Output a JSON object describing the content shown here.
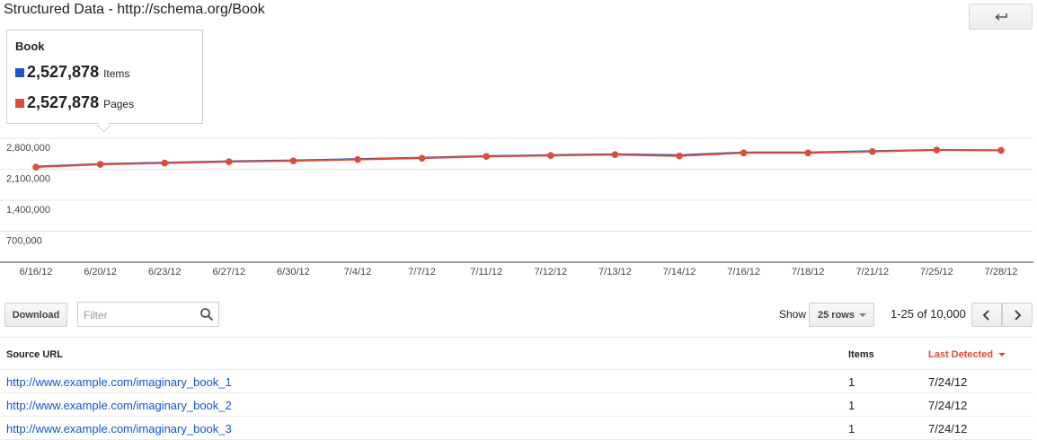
{
  "header": {
    "title": "Structured Data - http://schema.org/Book",
    "back_icon": "back-arrow-icon"
  },
  "tooltip": {
    "title": "Book",
    "metrics": [
      {
        "value": "2,527,878",
        "label": "Items",
        "color": "#1a56c9"
      },
      {
        "value": "2,527,878",
        "label": "Pages",
        "color": "#dd4b39"
      }
    ]
  },
  "chart_data": {
    "type": "line",
    "x": [
      "6/16/12",
      "6/20/12",
      "6/23/12",
      "6/27/12",
      "6/30/12",
      "7/4/12",
      "7/7/12",
      "7/11/12",
      "7/12/12",
      "7/13/12",
      "7/14/12",
      "7/16/12",
      "7/18/12",
      "7/21/12",
      "7/25/12",
      "7/28/12"
    ],
    "yticks": [
      "2,800,000",
      "2,100,000",
      "1,400,000",
      "700,000"
    ],
    "ylim": [
      0,
      2800000
    ],
    "series": [
      {
        "name": "Items",
        "color": "#1a56c9",
        "values": [
          2160000,
          2220000,
          2250000,
          2280000,
          2300000,
          2330000,
          2360000,
          2400000,
          2420000,
          2440000,
          2420000,
          2480000,
          2480000,
          2510000,
          2540000,
          2527878
        ]
      },
      {
        "name": "Pages",
        "color": "#dd4b39",
        "values": [
          2150000,
          2210000,
          2240000,
          2270000,
          2290000,
          2320000,
          2350000,
          2390000,
          2410000,
          2430000,
          2400000,
          2470000,
          2470000,
          2500000,
          2535000,
          2527878
        ]
      }
    ],
    "grid": true
  },
  "controls": {
    "download_label": "Download",
    "filter_placeholder": "Filter",
    "show_label": "Show",
    "rows_label": "25 rows",
    "pager_text": "1-25 of 10,000"
  },
  "table": {
    "columns": {
      "source": "Source URL",
      "items": "Items",
      "last_detected": "Last Detected"
    },
    "rows": [
      {
        "url": "http://www.example.com/imaginary_book_1",
        "items": "1",
        "date": "7/24/12"
      },
      {
        "url": "http://www.example.com/imaginary_book_2",
        "items": "1",
        "date": "7/24/12"
      },
      {
        "url": "http://www.example.com/imaginary_book_3",
        "items": "1",
        "date": "7/24/12"
      }
    ]
  }
}
